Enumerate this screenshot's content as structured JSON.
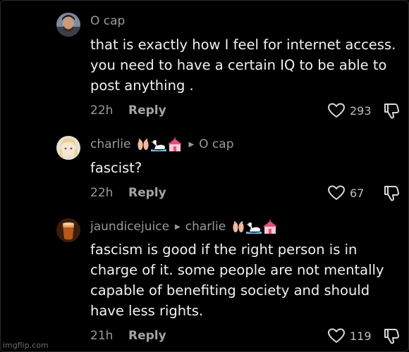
{
  "comments": [
    {
      "username": "O cap",
      "reply_to": "",
      "text": "that is exactly how I feel for internet access. you need to have a certain IQ to be able to post anything .",
      "time": "22h",
      "reply_label": "Reply",
      "likes": "293"
    },
    {
      "username": "charlie",
      "reply_to": "O cap",
      "text": "fascist?",
      "time": "22h",
      "reply_label": "Reply",
      "likes": "67"
    },
    {
      "username": "jaundicejuice",
      "reply_to": "charlie",
      "text": "fascism is good if the right person is in charge of it. some people are not mentally capable of benefiting society and should have less rights.",
      "time": "21h",
      "reply_label": "Reply",
      "likes": "119"
    }
  ],
  "watermark": "imgflip.com",
  "colors": {
    "background": "#000000",
    "text": "#f2f2f2",
    "muted": "#9a9a9a"
  },
  "icons": [
    "heart-icon",
    "dislike-icon",
    "reply-arrow-icon"
  ]
}
